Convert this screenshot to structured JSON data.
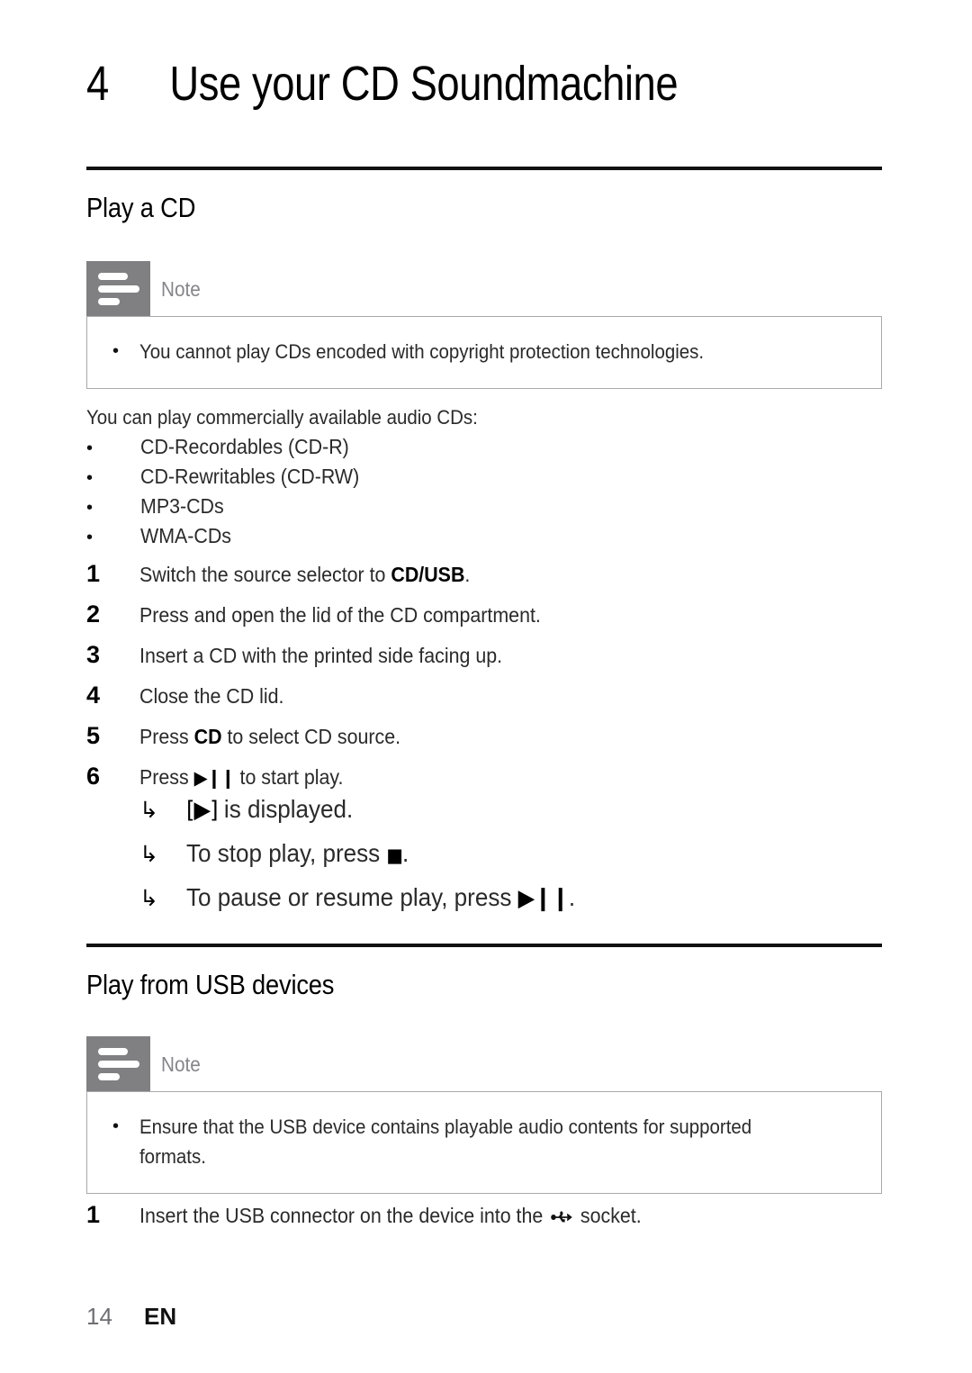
{
  "chapter": {
    "number": "4",
    "title": "Use your CD Soundmachine"
  },
  "sections": {
    "play_cd": {
      "heading": "Play a CD",
      "note": {
        "label": "Note",
        "icon": "note-lines-icon",
        "items": [
          "You cannot play CDs encoded with copyright protection technologies."
        ]
      },
      "intro": "You can play commercially available audio CDs:",
      "disc_types": [
        "CD-Recordables (CD-R)",
        "CD-Rewritables (CD-RW)",
        "MP3-CDs",
        "WMA-CDs"
      ],
      "steps": [
        {
          "num": "1",
          "pre": "Switch the source selector to ",
          "bold": "CD/USB",
          "post": "."
        },
        {
          "num": "2",
          "pre": "Press and open the lid of the CD compartment.",
          "bold": "",
          "post": ""
        },
        {
          "num": "3",
          "pre": "Insert a CD with the printed side facing up.",
          "bold": "",
          "post": ""
        },
        {
          "num": "4",
          "pre": "Close the CD lid.",
          "bold": "",
          "post": ""
        },
        {
          "num": "5",
          "pre": "Press ",
          "bold": "CD",
          "post": " to select CD source."
        },
        {
          "num": "6",
          "pre": "Press ",
          "glyph": "▶❙❙",
          "post": " to start play."
        }
      ],
      "results": [
        {
          "arrow": "↳",
          "pre": "",
          "glyph": "[▶]",
          "post": " is displayed."
        },
        {
          "arrow": "↳",
          "pre": "To stop play, press ",
          "glyph": "■",
          "post": "."
        },
        {
          "arrow": "↳",
          "pre": "To pause or resume play, press ",
          "glyph": "▶❙❙",
          "post": "."
        }
      ]
    },
    "play_usb": {
      "heading": "Play from USB devices",
      "note": {
        "label": "Note",
        "icon": "note-lines-icon",
        "items": [
          "Ensure that the USB device contains playable audio contents for supported formats."
        ]
      },
      "steps": [
        {
          "num": "1",
          "pre": "Insert the USB connector on the device into the ",
          "icon": "usb-trident-icon",
          "post": " socket."
        }
      ]
    }
  },
  "footer": {
    "page": "14",
    "language": "EN"
  },
  "colors": {
    "note_tab": "#808083",
    "note_border": "#a9a9ae",
    "rule": "#111111",
    "body_text": "#2a2a2a",
    "note_label": "#85858a",
    "footer_page": "#6f6f73"
  }
}
